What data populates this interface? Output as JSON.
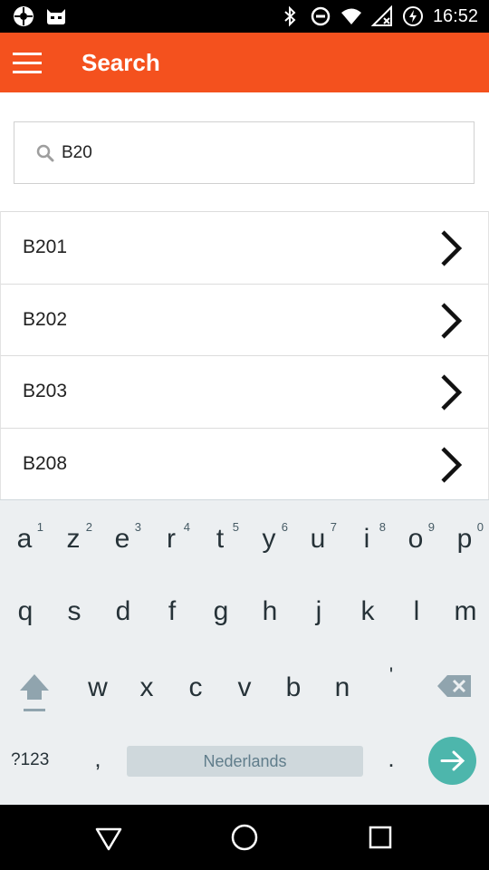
{
  "status_bar": {
    "time": "16:52",
    "icons": [
      "cyanogen-icon",
      "android-cat-icon",
      "bluetooth-icon",
      "do-not-disturb-icon",
      "wifi-icon",
      "no-signal-icon",
      "battery-charging-icon"
    ]
  },
  "app_bar": {
    "title": "Search",
    "menu_icon": "hamburger-menu-icon",
    "color": "#f4511e"
  },
  "search": {
    "value": "B20",
    "icon": "search-icon"
  },
  "results": [
    {
      "label": "B201"
    },
    {
      "label": "B202"
    },
    {
      "label": "B203"
    },
    {
      "label": "B208"
    }
  ],
  "keyboard": {
    "row1": [
      {
        "key": "a",
        "hint": "1"
      },
      {
        "key": "z",
        "hint": "2"
      },
      {
        "key": "e",
        "hint": "3"
      },
      {
        "key": "r",
        "hint": "4"
      },
      {
        "key": "t",
        "hint": "5"
      },
      {
        "key": "y",
        "hint": "6"
      },
      {
        "key": "u",
        "hint": "7"
      },
      {
        "key": "i",
        "hint": "8"
      },
      {
        "key": "o",
        "hint": "9"
      },
      {
        "key": "p",
        "hint": "0"
      }
    ],
    "row2": [
      "q",
      "s",
      "d",
      "f",
      "g",
      "h",
      "j",
      "k",
      "l",
      "m"
    ],
    "row3": [
      "w",
      "x",
      "c",
      "v",
      "b",
      "n",
      "'"
    ],
    "symbols_label": "?123",
    "comma": ",",
    "space_label": "Nederlands",
    "period": ".",
    "accent_color": "#4db6ac"
  },
  "nav_bar": {
    "icons": [
      "back-icon",
      "home-icon",
      "recents-icon"
    ]
  }
}
